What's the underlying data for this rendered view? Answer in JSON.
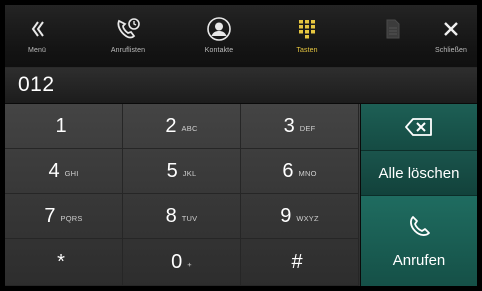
{
  "toolbar": {
    "items": [
      {
        "label": "Menü",
        "icon": "double-chevron-left-icon",
        "active": false
      },
      {
        "label": "Anruflisten",
        "icon": "call-history-icon",
        "active": false
      },
      {
        "label": "Kontakte",
        "icon": "contact-icon",
        "active": false
      },
      {
        "label": "Tasten",
        "icon": "keypad-icon",
        "active": true
      },
      {
        "label": "",
        "icon": "document-icon",
        "active": false
      },
      {
        "label": "Schließen",
        "icon": "close-icon",
        "active": false
      }
    ],
    "active_color": "#e6c640"
  },
  "display": {
    "number": "012"
  },
  "keypad": {
    "keys": [
      {
        "digit": "1",
        "letters": ""
      },
      {
        "digit": "2",
        "letters": "ABC"
      },
      {
        "digit": "3",
        "letters": "DEF"
      },
      {
        "digit": "4",
        "letters": "GHI"
      },
      {
        "digit": "5",
        "letters": "JKL"
      },
      {
        "digit": "6",
        "letters": "MNO"
      },
      {
        "digit": "7",
        "letters": "PQRS"
      },
      {
        "digit": "8",
        "letters": "TUV"
      },
      {
        "digit": "9",
        "letters": "WXYZ"
      },
      {
        "digit": "*",
        "letters": ""
      },
      {
        "digit": "0",
        "letters": "+"
      },
      {
        "digit": "#",
        "letters": ""
      }
    ]
  },
  "actions": {
    "backspace_icon": "backspace-icon",
    "clear_label": "Alle löschen",
    "call_label": "Anrufen",
    "call_icon": "phone-handset-icon",
    "accent_color": "#1d5f55"
  }
}
